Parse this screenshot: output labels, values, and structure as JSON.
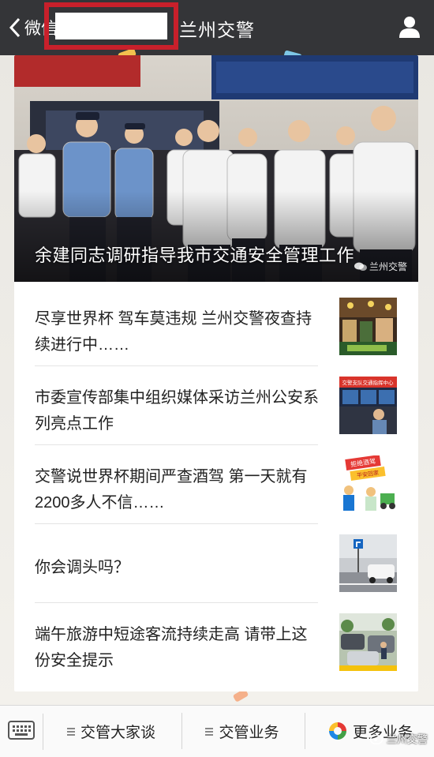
{
  "header": {
    "back_label": "微信",
    "title": "兰州交警"
  },
  "hero": {
    "caption": "余建同志调研指导我市交通安全管理工作",
    "watermark": "兰州交警"
  },
  "articles": [
    {
      "title": "尽享世界杯 驾车莫违规 兰州交警夜查持续进行中……"
    },
    {
      "title": "市委宣传部集中组织媒体采访兰州公安系列亮点工作"
    },
    {
      "title": "交警说世界杯期间严查酒驾 第一天就有2200多人不信……"
    },
    {
      "title": "你会调头吗？"
    },
    {
      "title": "端午旅游中短途客流持续走高 请带上这份安全提示"
    }
  ],
  "thumb_text": {
    "t2_banner": "交警支队交通指挥中心",
    "t3_sign1": "拒绝酒驾",
    "t3_sign2": "平安回家"
  },
  "tabbar": {
    "tab1": "交管大家谈",
    "tab2": "交管业务",
    "tab3": "更多业务"
  },
  "overlay_watermark": "兰州交警",
  "colors": {
    "header_bg": "#343538",
    "highlight_border": "#c8202b"
  }
}
